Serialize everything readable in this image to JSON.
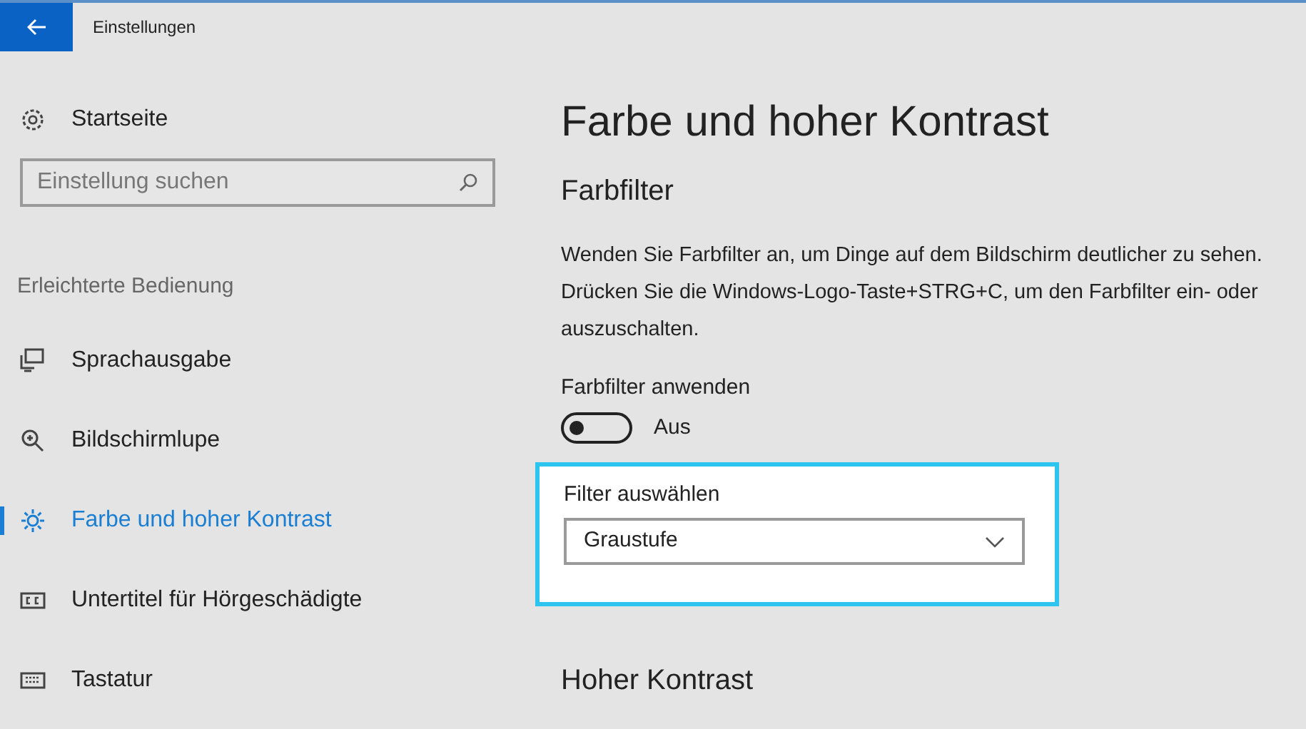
{
  "window": {
    "title": "Einstellungen"
  },
  "sidebar": {
    "home": "Startseite",
    "search": {
      "placeholder": "Einstellung suchen"
    },
    "section": "Erleichterte Bedienung",
    "items": [
      {
        "label": "Sprachausgabe",
        "selected": false
      },
      {
        "label": "Bildschirmlupe",
        "selected": false
      },
      {
        "label": "Farbe und hoher Kontrast",
        "selected": true
      },
      {
        "label": "Untertitel für Hörgeschädigte",
        "selected": false
      },
      {
        "label": "Tastatur",
        "selected": false
      }
    ]
  },
  "content": {
    "title": "Farbe und hoher Kontrast",
    "section": "Farbfilter",
    "description": "Wenden Sie Farbfilter an, um Dinge auf dem Bildschirm deutlicher zu sehen. Drücken Sie die Windows-Logo-Taste+STRG+C, um den Farbfilter ein- oder auszuschalten.",
    "toggle": {
      "label": "Farbfilter anwenden",
      "on": false,
      "state_text": "Aus"
    },
    "filter": {
      "label": "Filter auswählen",
      "value": "Graustufe"
    },
    "next_section": "Hoher Kontrast"
  }
}
